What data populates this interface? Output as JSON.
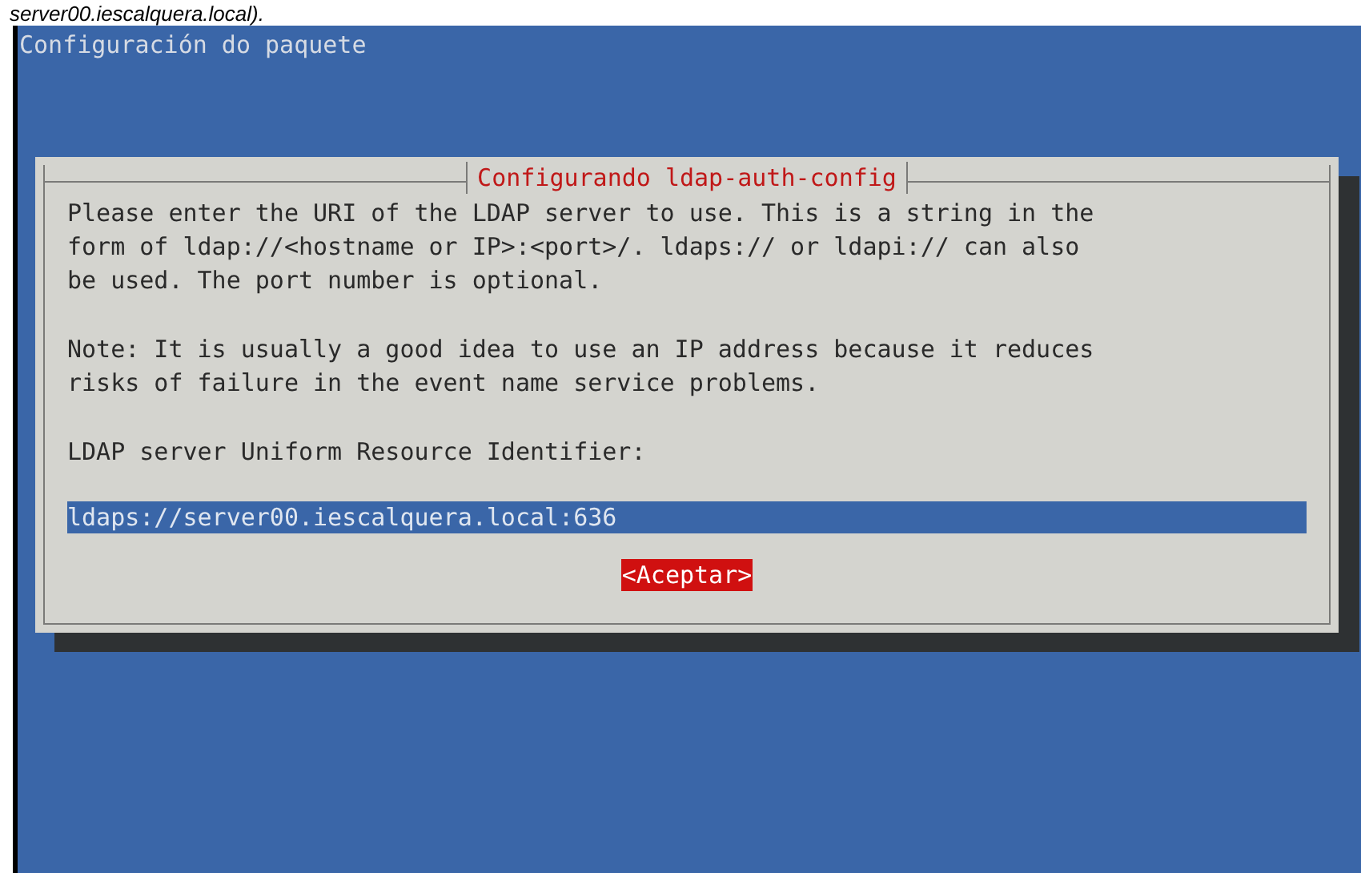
{
  "caption": "server00.iescalquera.local).",
  "screen_title": "Configuración do paquete",
  "dialog": {
    "title": "Configurando ldap-auth-config",
    "paragraphs": [
      "Please enter the URI of the LDAP server to use. This is a string in the\nform of ldap://<hostname or IP>:<port>/. ldaps:// or ldapi:// can also\nbe used. The port number is optional.",
      "Note: It is usually a good idea to use an IP address because it reduces\nrisks of failure in the event name service problems.",
      "LDAP server Uniform Resource Identifier:"
    ],
    "input": {
      "value": "ldaps://server00.iescalquera.local:636"
    },
    "button": {
      "label": "<Aceptar>",
      "selected": true
    }
  }
}
